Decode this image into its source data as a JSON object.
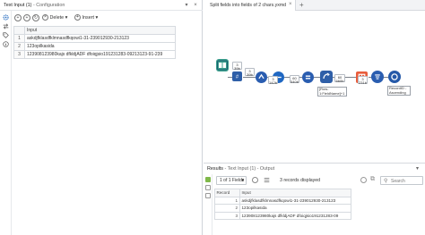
{
  "config": {
    "title": "Text Input (1)",
    "subtitle": "- Configuration",
    "toolbar": {
      "delete_label": "Delete",
      "insert_label": "Insert"
    },
    "grid": {
      "header": "Input",
      "rows": [
        {
          "num": "1",
          "value": "askdjfklasdfklmnasdfkqowi1-31-239012930-213123"
        },
        {
          "num": "2",
          "value": "123opilkasida"
        },
        {
          "num": "3",
          "value": "123908123980kajs dfkldjADF dfoiqjsio191231283-09213123-91-239"
        }
      ]
    }
  },
  "workflow": {
    "tab_label": "Split fields into fields of 2 chars.yxmd",
    "badges": [
      "3\n39b",
      "3\n39b",
      "3\n142b",
      "60\n540b",
      "60\n660b",
      "3\n231b"
    ],
    "annotations": {
      "multirow": "[Row-1:FieldName]+1",
      "sort": "RecordID -\nAscending"
    }
  },
  "results": {
    "title": "Results",
    "subtitle": "- Text Input (1) - Output",
    "fields_label": "1 of 1 Fields",
    "record_count": "3 records displayed",
    "search_placeholder": "Search",
    "columns": [
      "Record",
      "Input"
    ],
    "rows": [
      {
        "rec": "1",
        "value": "askdjfklasdfklmnasdfkqowi1-31-239012930-213123"
      },
      {
        "rec": "2",
        "value": "123opilkasida"
      },
      {
        "rec": "3",
        "value": "123908123980kajs dfkldjADF dfoiqjsio191231283-09"
      }
    ]
  },
  "colors": {
    "input_tool": "#3a9e8c",
    "id_tool": "#2f5fa8",
    "select_tool": "#1f67c2",
    "sort_tool": "#2a5db0",
    "output_tool": "#2559a8",
    "formula_tool": "#e85d3c"
  }
}
